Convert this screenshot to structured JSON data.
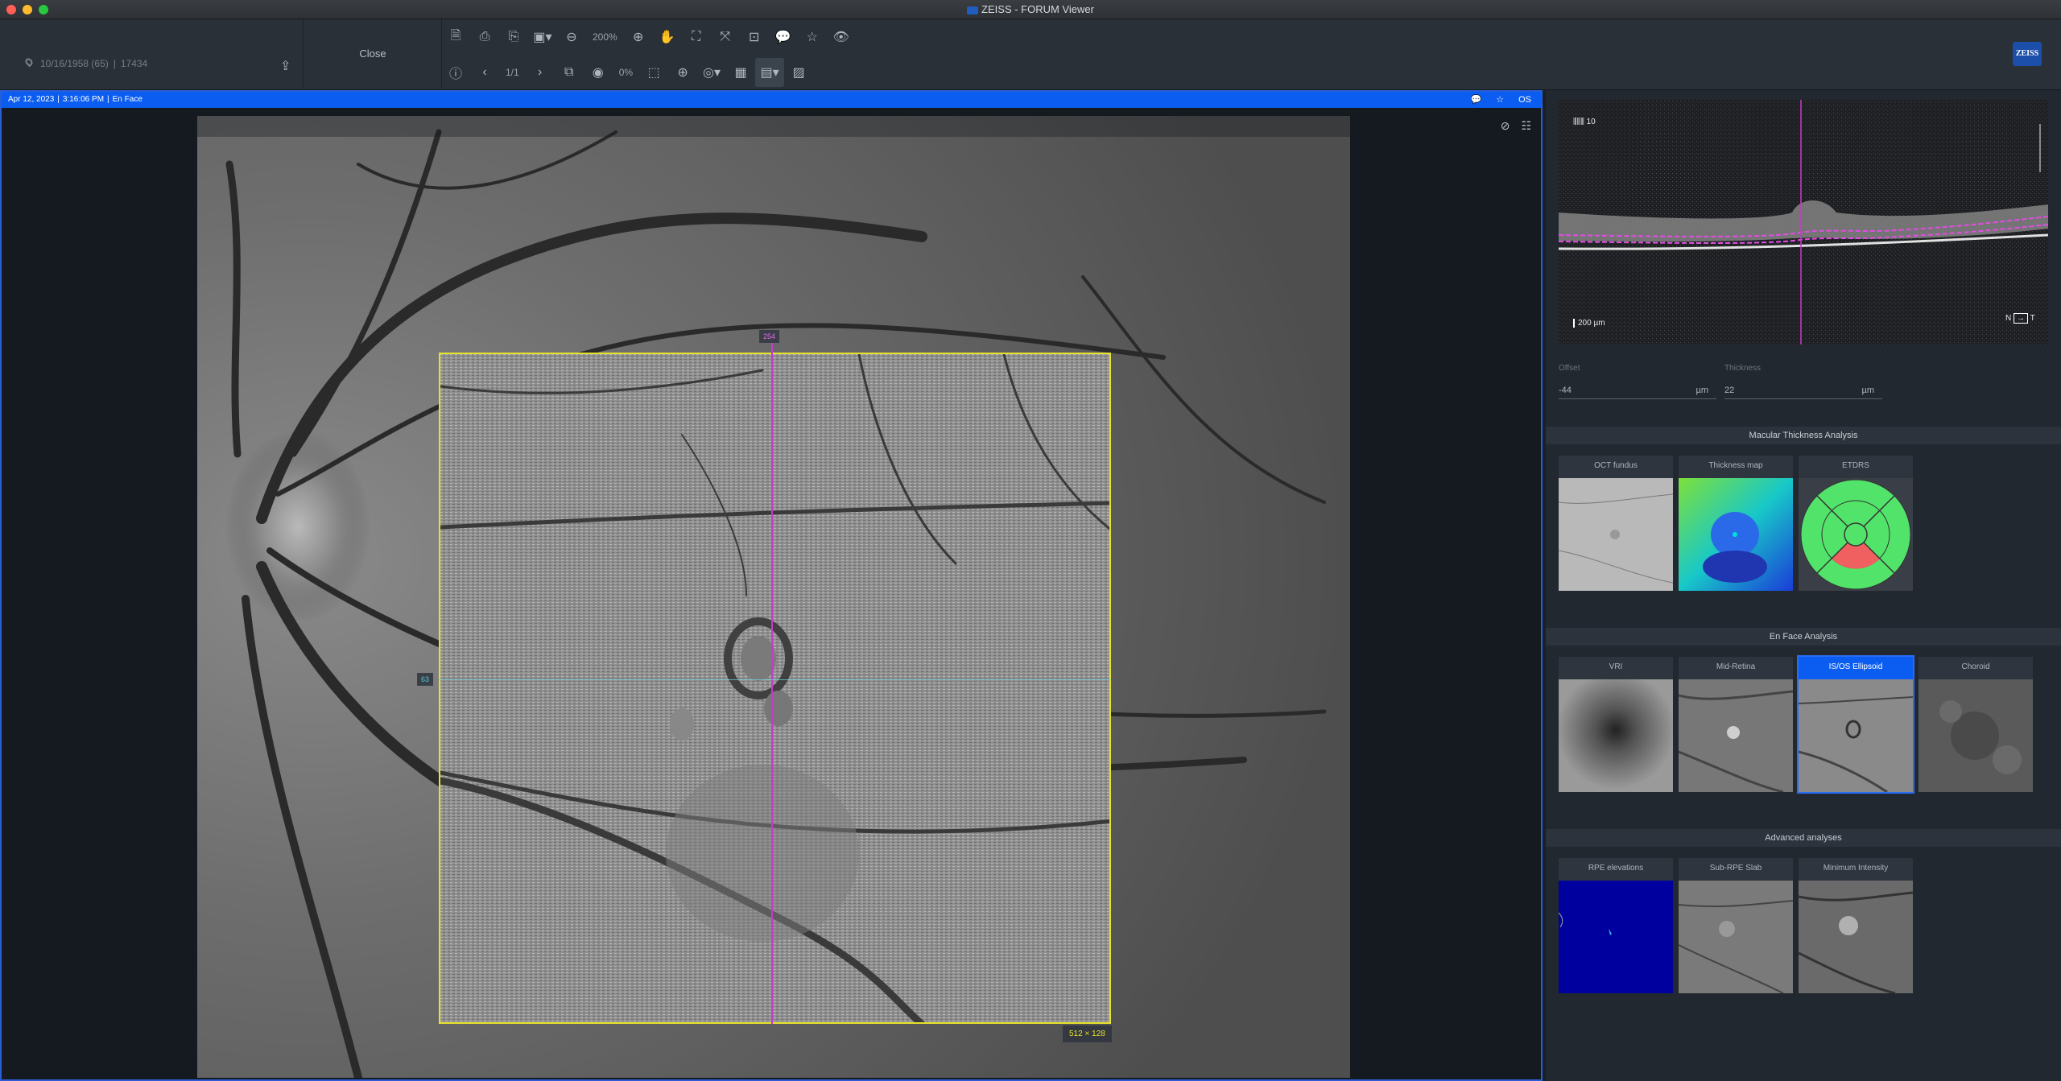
{
  "window": {
    "title": "ZEISS - FORUM Viewer"
  },
  "toolbar": {
    "patient_dob": "10/16/1958 (65)",
    "patient_id": "17434",
    "close_label": "Close",
    "zoom_level": "200%",
    "page_indicator": "1/1",
    "opacity_level": "0%",
    "brand": "ZEISS"
  },
  "viewer": {
    "date": "Apr 12, 2023",
    "time": "3:16:06 PM",
    "mode": "En Face",
    "eye": "OS",
    "vertical_marker": "254",
    "horizontal_marker": "63",
    "scan_size": "512 × 128"
  },
  "bscan": {
    "scale_label": "200 µm",
    "orientation_left": "N",
    "orientation_right": "T",
    "slice_label": "10"
  },
  "layer_controls": {
    "offset_label": "Offset",
    "offset_value": "-44",
    "offset_unit": "µm",
    "thickness_label": "Thickness",
    "thickness_value": "22",
    "thickness_unit": "µm"
  },
  "sections": {
    "macular": {
      "title": "Macular Thickness Analysis",
      "thumbs": [
        "OCT fundus",
        "Thickness map",
        "ETDRS"
      ]
    },
    "enface": {
      "title": "En Face Analysis",
      "thumbs": [
        "VRI",
        "Mid-Retina",
        "IS/OS Ellipsoid",
        "Choroid"
      ],
      "selected": "IS/OS Ellipsoid"
    },
    "advanced": {
      "title": "Advanced analyses",
      "thumbs": [
        "RPE elevations",
        "Sub-RPE Slab",
        "Minimum Intensity"
      ]
    }
  },
  "colors": {
    "accent_blue": "#0b5df1",
    "overlay_yellow": "#e6e22a",
    "marker_magenta": "#c83ac8",
    "marker_cyan": "#6ad6e0",
    "rpe_blue": "#00009e"
  }
}
